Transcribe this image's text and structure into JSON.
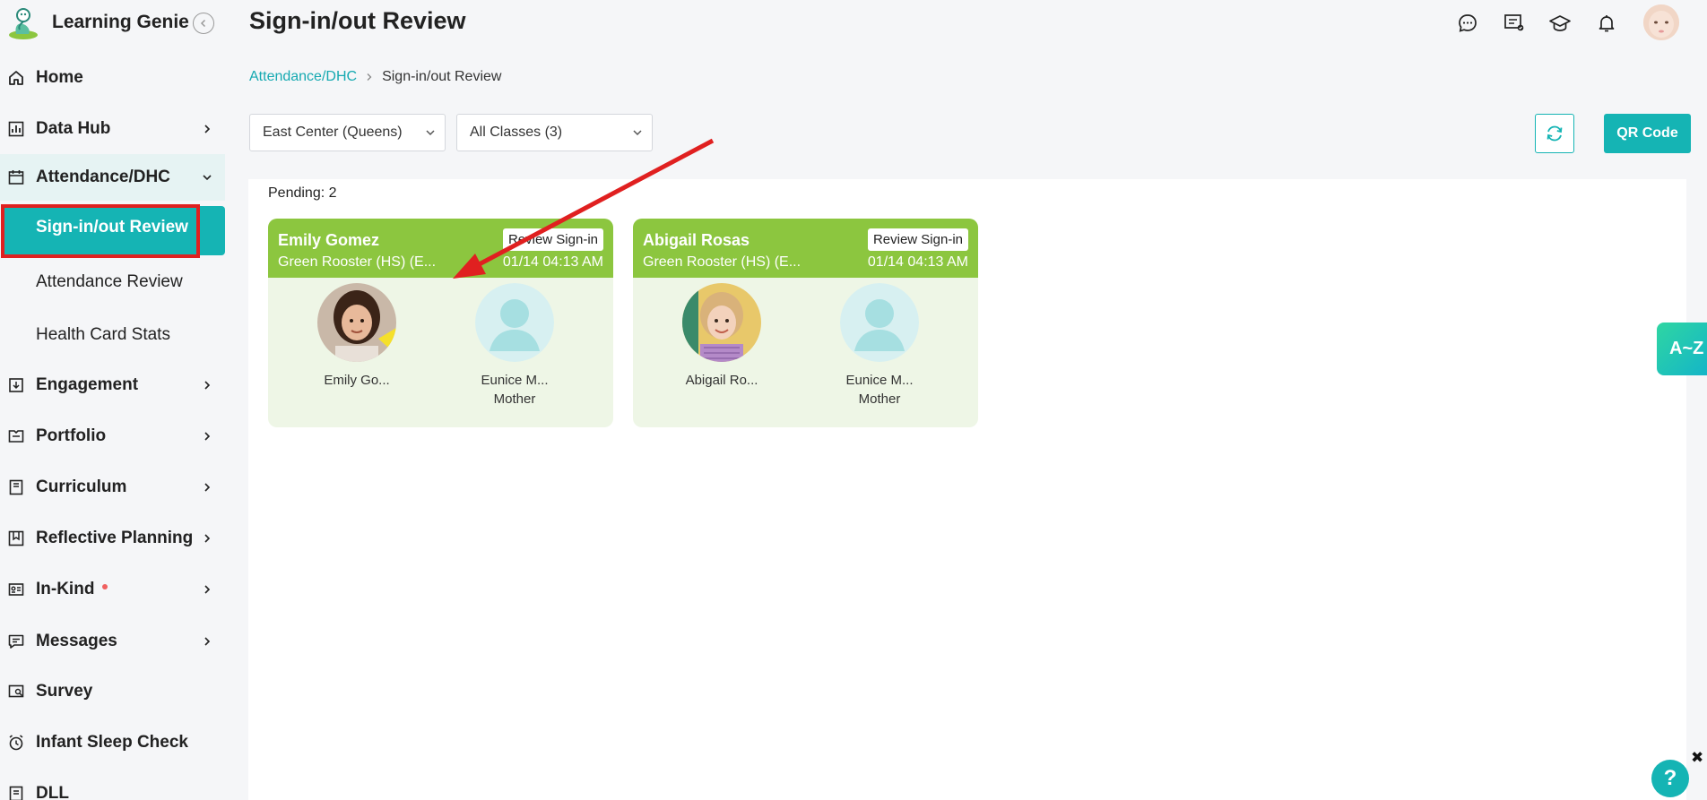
{
  "app": {
    "name": "Learning Genie"
  },
  "page": {
    "title": "Sign-in/out Review"
  },
  "sidebar": {
    "items": [
      {
        "label": "Home"
      },
      {
        "label": "Data Hub"
      },
      {
        "label": "Attendance/DHC"
      },
      {
        "label": "Sign-in/out Review"
      },
      {
        "label": "Attendance Review"
      },
      {
        "label": "Health Card Stats"
      },
      {
        "label": "Engagement"
      },
      {
        "label": "Portfolio"
      },
      {
        "label": "Curriculum"
      },
      {
        "label": "Reflective Planning"
      },
      {
        "label": "In-Kind"
      },
      {
        "label": "Messages"
      },
      {
        "label": "Survey"
      },
      {
        "label": "Infant Sleep Check"
      },
      {
        "label": "DLL"
      }
    ]
  },
  "breadcrumb": {
    "parent": "Attendance/DHC",
    "current": "Sign-in/out Review"
  },
  "filters": {
    "center": "East Center (Queens)",
    "classes": "All Classes (3)"
  },
  "actions": {
    "qr_label": "QR Code"
  },
  "pending": {
    "label": "Pending: 2"
  },
  "cards": [
    {
      "name": "Emily Gomez",
      "class": "Green Rooster (HS) (E...",
      "time": "01/14 04:13 AM",
      "review_label": "Review Sign-in",
      "child_name": "Emily Go...",
      "parent_name": "Eunice M...",
      "parent_relation": "Mother"
    },
    {
      "name": "Abigail Rosas",
      "class": "Green Rooster (HS) (E...",
      "time": "01/14 04:13 AM",
      "review_label": "Review Sign-in",
      "child_name": "Abigail Ro...",
      "parent_name": "Eunice M...",
      "parent_relation": "Mother"
    }
  ],
  "floating": {
    "az_label": "A~Z",
    "help_label": "?",
    "close_label": "✖"
  },
  "colors": {
    "accent": "#15b4b4",
    "card_header": "#8cc63f",
    "card_body": "#eef6e6",
    "highlight": "#e02020"
  }
}
